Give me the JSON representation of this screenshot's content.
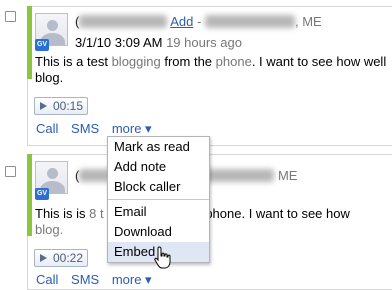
{
  "entries": [
    {
      "name_redacted": "(",
      "add_link": "Add",
      "separator": "-",
      "location_suffix": ", ME",
      "date": "3/1/10 3:09 AM",
      "relative_time": "19 hours ago",
      "message": {
        "part1": "This is a test ",
        "hl1": "blogging",
        "part2": " from the ",
        "hl2": "phone",
        "part3": ". I want to see how well",
        "line2": "blog."
      },
      "duration": "00:15",
      "actions": {
        "call": "Call",
        "sms": "SMS",
        "more": "more ▾"
      }
    },
    {
      "name_redacted": "(",
      "location_suffix": "ME",
      "message": {
        "part1": "This is is ",
        "hl1": "8 t",
        "part3": "the phone. I want to see how",
        "line2": "blog."
      },
      "duration": "00:22",
      "actions": {
        "call": "Call",
        "sms": "SMS",
        "more": "more ▾"
      }
    }
  ],
  "menu": {
    "group1": [
      "Mark as read",
      "Add note",
      "Block caller"
    ],
    "group2": [
      "Email",
      "Download",
      "Embed"
    ],
    "highlighted": "Embed"
  },
  "badge_text": "GV",
  "colors": {
    "link": "#2a5db0",
    "accent_bar": "#8cc63f",
    "muted": "#777777",
    "menu_highlight": "#dfe7f5"
  }
}
